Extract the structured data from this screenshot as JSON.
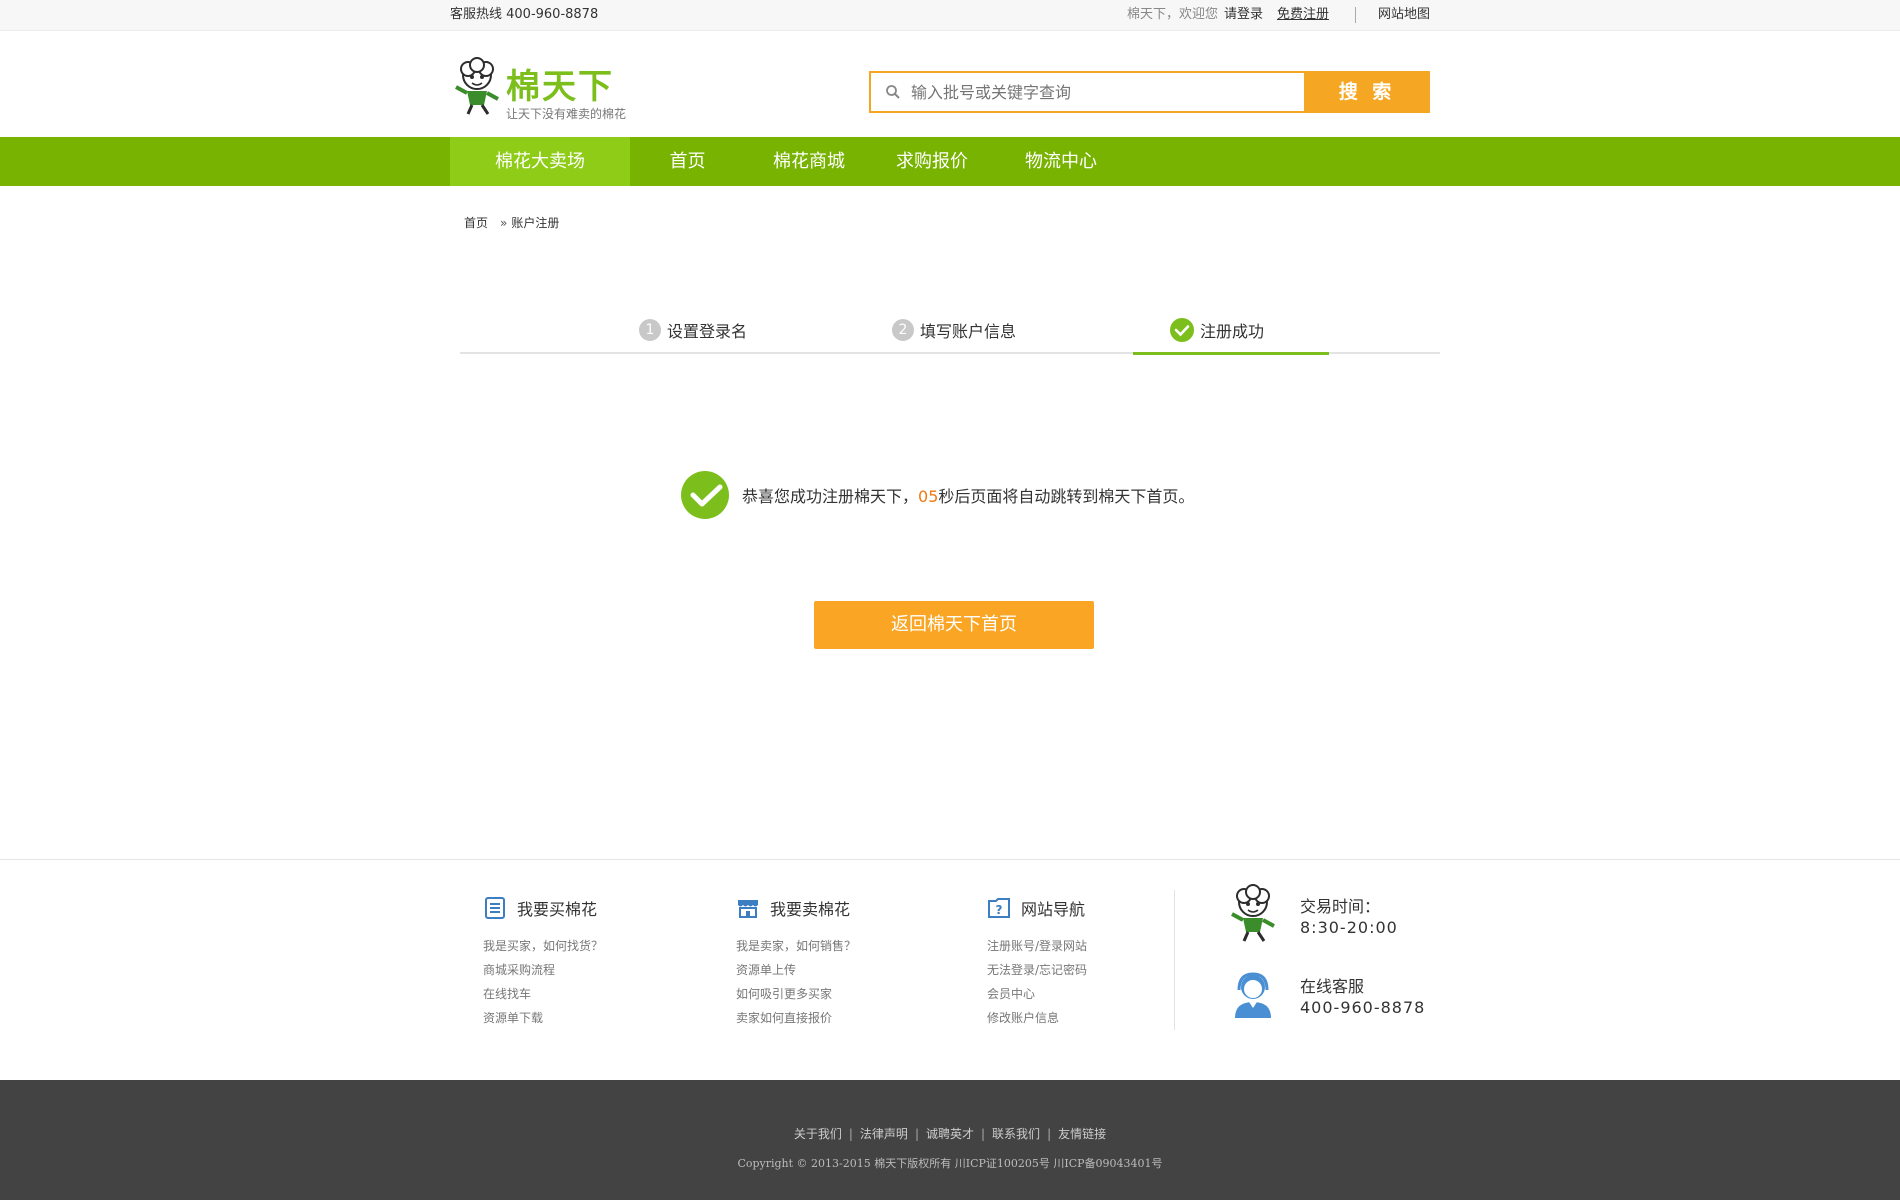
{
  "topbar": {
    "hotline": "客服热线 400-960-8878",
    "welcome": "棉天下，欢迎您",
    "login": "请登录",
    "register": "免费注册",
    "sitemap": "网站地图"
  },
  "logo": {
    "brand": "棉天下",
    "slogan": "让天下没有难卖的棉花"
  },
  "search": {
    "placeholder": "输入批号或关键字查询",
    "button": "搜 索"
  },
  "nav": {
    "items": [
      {
        "label": "棉花大卖场"
      },
      {
        "label": "首页"
      },
      {
        "label": "棉花商城"
      },
      {
        "label": "求购报价"
      },
      {
        "label": "物流中心"
      }
    ]
  },
  "breadcrumb": {
    "home": "首页",
    "current": "账户注册"
  },
  "steps": [
    {
      "num": "1",
      "label": "设置登录名"
    },
    {
      "num": "2",
      "label": "填写账户信息"
    },
    {
      "label": "注册成功"
    }
  ],
  "success": {
    "prefix": "恭喜您成功注册棉天下，",
    "countdown": "05",
    "suffix": "秒后页面将自动跳转到棉天下首页。",
    "home_button": "返回棉天下首页"
  },
  "footer": {
    "columns": [
      {
        "title": "我要买棉花",
        "links": [
          "我是买家，如何找货？",
          "商城采购流程",
          "在线找车",
          "资源单下载"
        ]
      },
      {
        "title": "我要卖棉花",
        "links": [
          "我是卖家，如何销售？",
          "资源单上传",
          "如何吸引更多买家",
          "卖家如何直接报价"
        ]
      },
      {
        "title": "网站导航",
        "links": [
          "注册账号/登录网站",
          "无法登录/忘记密码",
          "会员中心",
          "修改账户信息"
        ]
      }
    ],
    "trade_time_label": "交易时间：",
    "trade_time": "8:30-20:00",
    "online_service_label": "在线客服",
    "online_service_phone": "400-960-8878"
  },
  "bottom": {
    "links": [
      "关于我们",
      "法律声明",
      "诚聘英才",
      "联系我们",
      "友情链接"
    ],
    "copyright": "Copyright © 2013-2015 棉天下版权所有 川ICP证100205号 川ICP备09043401号"
  },
  "colors": {
    "brand_green": "#77b300",
    "nav_active": "#8fcc17",
    "accent_orange": "#f5a623",
    "countdown": "#f07a12"
  }
}
